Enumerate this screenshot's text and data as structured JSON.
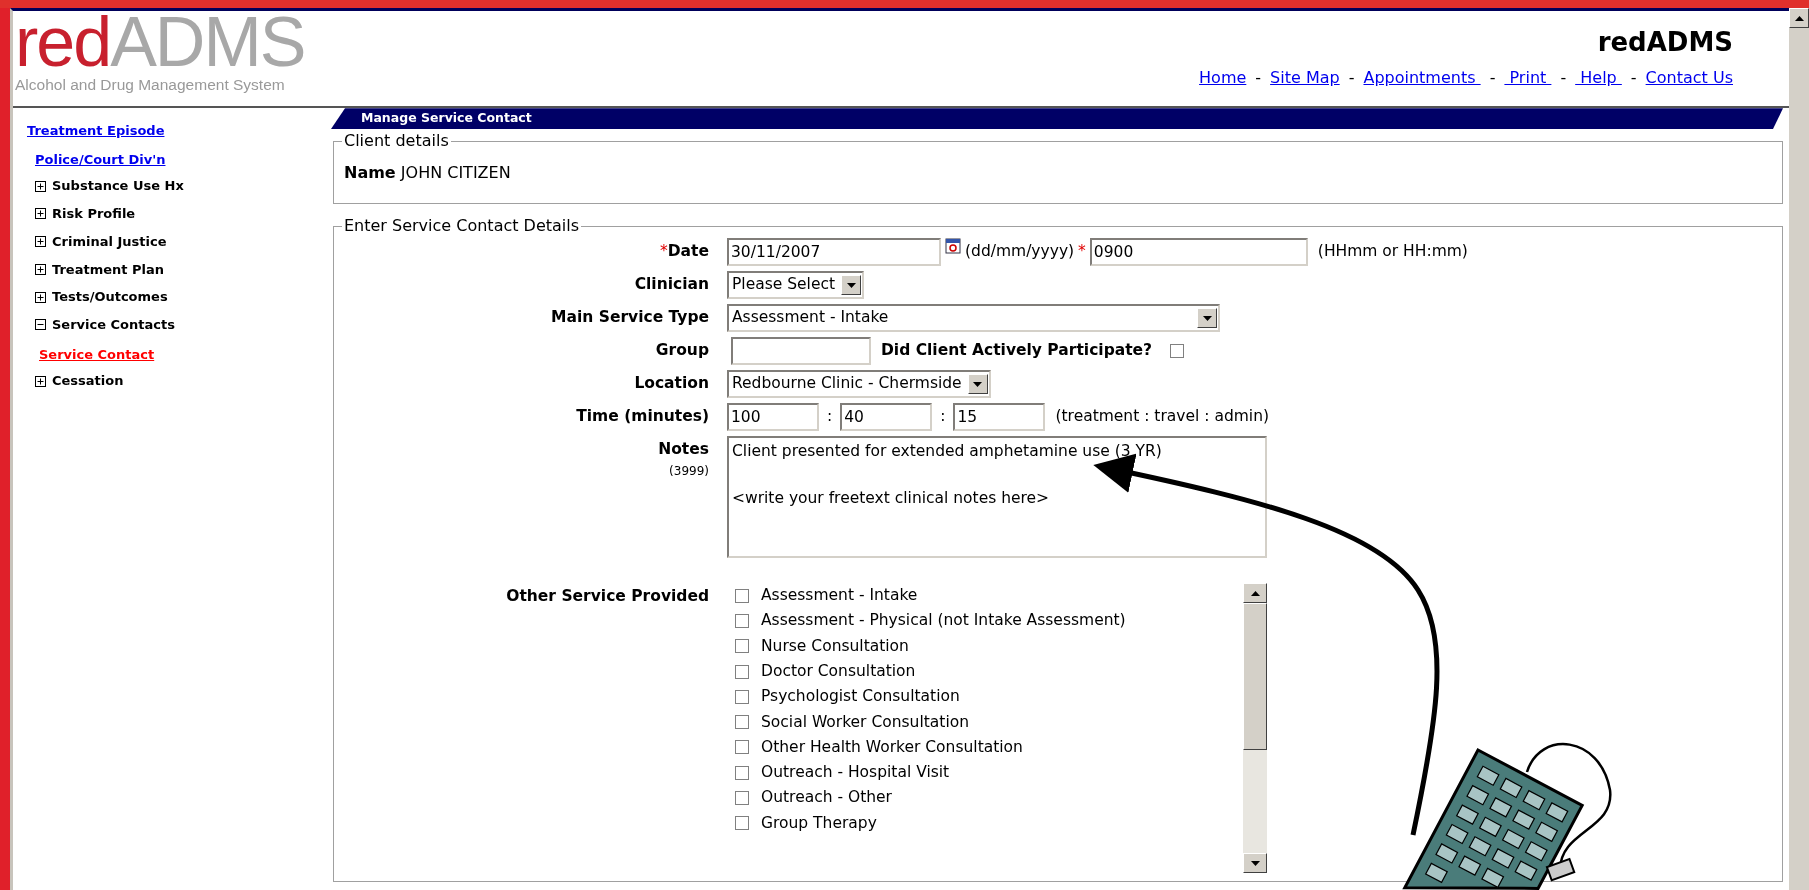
{
  "header": {
    "logo": {
      "red_part": "red",
      "grey_part": "ADMS"
    },
    "subtitle": "Alcohol and Drug Management System",
    "title": "redADMS",
    "nav": [
      {
        "kind": "link",
        "label": "Home"
      },
      {
        "kind": "separator",
        "label": "-"
      },
      {
        "kind": "link",
        "label": "Site Map"
      },
      {
        "kind": "separator",
        "label": "-"
      },
      {
        "kind": "link",
        "label": "Appointments "
      },
      {
        "kind": "separator",
        "label": "-"
      },
      {
        "kind": "link",
        "label": " Print "
      },
      {
        "kind": "separator",
        "label": "-"
      },
      {
        "kind": "link",
        "label": " Help "
      },
      {
        "kind": "separator",
        "label": "-"
      },
      {
        "kind": "link",
        "label": "Contact Us"
      }
    ]
  },
  "sidebar": {
    "items": [
      {
        "kind": "link",
        "label": "Treatment Episode",
        "selected": false,
        "children": [
          {
            "kind": "link",
            "label": "Police/Court Div'n",
            "selected": false
          },
          {
            "kind": "node",
            "label": "Substance Use Hx",
            "expanded": false
          },
          {
            "kind": "node",
            "label": "Risk Profile",
            "expanded": false
          },
          {
            "kind": "node",
            "label": "Criminal Justice",
            "expanded": false
          },
          {
            "kind": "node",
            "label": "Treatment Plan",
            "expanded": false
          },
          {
            "kind": "node",
            "label": "Tests/Outcomes",
            "expanded": false
          },
          {
            "kind": "node",
            "label": "Service Contacts",
            "expanded": true,
            "children": [
              {
                "kind": "link",
                "label": "Service Contact",
                "selected": true
              }
            ]
          },
          {
            "kind": "node",
            "label": "Cessation",
            "expanded": false
          }
        ]
      }
    ]
  },
  "panel_title": "Manage Service Contact",
  "client_details": {
    "legend": "Client details",
    "name_label": "Name",
    "name_value": "JOHN CITIZEN"
  },
  "service_contact": {
    "legend": "Enter Service Contact Details",
    "fields": [
      {
        "kind": "datetime",
        "label": "Date",
        "required_mark": "*",
        "value": "30/11/2007",
        "hint": "(dd/mm/yyyy)",
        "time_required_mark": "*",
        "time_value": "0900",
        "time_hint": "(HHmm or HH:mm)"
      },
      {
        "kind": "select",
        "label": "Clinician",
        "value": "Please Select",
        "wide": false
      },
      {
        "kind": "select",
        "label": "Main Service Type",
        "value": "Assessment - Intake",
        "wide": true
      },
      {
        "kind": "text_check",
        "label": "Group",
        "check_label": "Did Client Actively Participate?",
        "checked": false
      },
      {
        "kind": "select",
        "label": "Location",
        "value": "Redbourne Clinic - Chermside",
        "wide": false
      },
      {
        "kind": "triple",
        "label": "Time (minutes)",
        "values": [
          "100",
          "40",
          "15"
        ],
        "separators": [
          ":",
          ":"
        ],
        "hint": "(treatment : travel : admin)"
      },
      {
        "kind": "textarea",
        "label": "Notes",
        "counter": "(3999)",
        "value": "Client presented for extended amphetamine use (3 YR)\n\n<write your freetext clinical notes here>"
      },
      {
        "kind": "checklist",
        "label": "Other Service Provided",
        "options": [
          {
            "label": "Assessment - Intake",
            "checked": false
          },
          {
            "label": "Assessment - Physical (not Intake Assessment)",
            "checked": false
          },
          {
            "label": "Nurse Consultation",
            "checked": false
          },
          {
            "label": "Doctor Consultation",
            "checked": false
          },
          {
            "label": "Psychologist Consultation",
            "checked": false
          },
          {
            "label": "Social Worker Consultation",
            "checked": false
          },
          {
            "label": "Other Health Worker Consultation",
            "checked": false
          },
          {
            "label": "Outreach - Hospital Visit",
            "checked": false
          },
          {
            "label": "Outreach - Other",
            "checked": false
          },
          {
            "label": "Group Therapy",
            "checked": false
          }
        ]
      }
    ]
  }
}
